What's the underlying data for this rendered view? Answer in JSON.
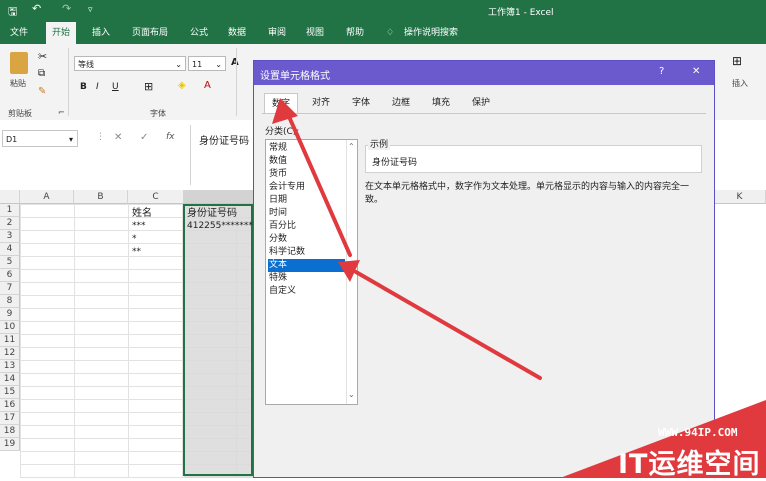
{
  "window": {
    "title": "工作簿1 - Excel"
  },
  "menu": {
    "file": "文件",
    "home": "开始",
    "insert": "插入",
    "page_layout": "页面布局",
    "formulas": "公式",
    "data": "数据",
    "review": "审阅",
    "view": "视图",
    "help": "帮助",
    "tell_me": "操作说明搜索"
  },
  "ribbon": {
    "paste": "粘贴",
    "clipboard": "剪贴板",
    "font_name": "等线",
    "font_size": "11",
    "font_group": "字体",
    "bold": "B",
    "italic": "I",
    "underline": "U",
    "insert": "插入",
    "grow_font": "A"
  },
  "formula_bar": {
    "name_box": "D1",
    "fx": "fx",
    "content": "身份证号码"
  },
  "grid": {
    "columns": [
      "A",
      "B",
      "C",
      "K"
    ],
    "rows": [
      "1",
      "2",
      "3",
      "4",
      "5",
      "6",
      "7",
      "8",
      "9",
      "10",
      "11",
      "12",
      "13",
      "14",
      "15",
      "16",
      "17",
      "18",
      "19"
    ],
    "c1": "姓名",
    "d1": "身份证号码",
    "c2": "***",
    "d2": "412255*******",
    "c3": "*",
    "c4": "**"
  },
  "dialog": {
    "title": "设置单元格格式",
    "help": "?",
    "close": "✕",
    "tabs": [
      "数字",
      "对齐",
      "字体",
      "边框",
      "填充",
      "保护"
    ],
    "category_label": "分类(C):",
    "categories": [
      "常规",
      "数值",
      "货币",
      "会计专用",
      "日期",
      "时间",
      "百分比",
      "分数",
      "科学记数",
      "文本",
      "特殊",
      "自定义"
    ],
    "selected_category": "文本",
    "sample_label": "示例",
    "sample_value": "身份证号码",
    "description": "在文本单元格格式中，数字作为文本处理。单元格显示的内容与输入的内容完全一致。"
  },
  "watermark": {
    "url": "WWW.94IP.COM",
    "brand": "IT运维空间"
  },
  "colors": {
    "excel_green": "#217346",
    "dialog_title": "#6a5acd",
    "selection": "#0a6fd1",
    "arrow": "#e0393e"
  }
}
